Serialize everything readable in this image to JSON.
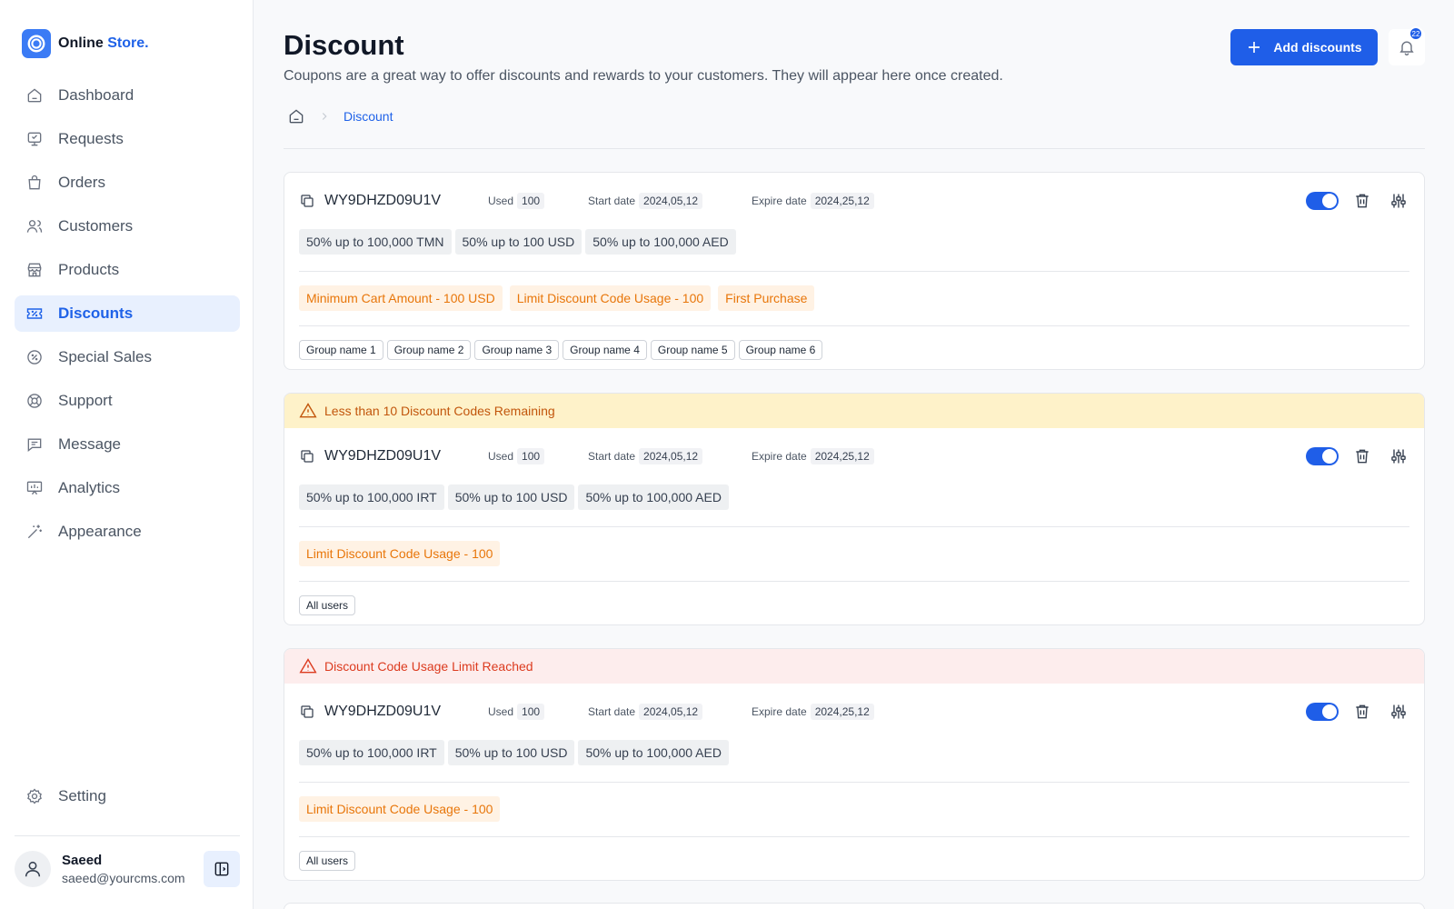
{
  "brand": {
    "name": "Online",
    "accent": "Store."
  },
  "sidebar": {
    "items": [
      {
        "label": "Dashboard",
        "icon": "dashboard-icon"
      },
      {
        "label": "Requests",
        "icon": "requests-icon"
      },
      {
        "label": "Orders",
        "icon": "orders-icon"
      },
      {
        "label": "Customers",
        "icon": "customers-icon"
      },
      {
        "label": "Products",
        "icon": "products-icon"
      },
      {
        "label": "Discounts",
        "icon": "discounts-icon",
        "active": true
      },
      {
        "label": "Special Sales",
        "icon": "special-sales-icon"
      },
      {
        "label": "Support",
        "icon": "support-icon"
      },
      {
        "label": "Message",
        "icon": "message-icon"
      },
      {
        "label": "Analytics",
        "icon": "analytics-icon"
      },
      {
        "label": "Appearance",
        "icon": "appearance-icon"
      }
    ],
    "setting_label": "Setting"
  },
  "user": {
    "name": "Saeed",
    "email": "saeed@yourcms.com"
  },
  "header": {
    "title": "Discount",
    "subtitle": "Coupons are a great way to offer discounts and rewards to your customers. They will appear here once created.",
    "add_button": "Add discounts",
    "notification_count": "22"
  },
  "breadcrumb": {
    "current": "Discount"
  },
  "labels": {
    "used": "Used",
    "start_date": "Start date",
    "expire_date": "Expire date"
  },
  "colors": {
    "primary": "#1f5ee8",
    "warning_bg": "#fef2c9",
    "danger_bg": "#fdeded",
    "condition": "#e8760a"
  },
  "discounts": [
    {
      "alert": null,
      "code": "WY9DHZD09U1V",
      "used": "100",
      "start_date": "2024,05,12",
      "expire_date": "2024,25,12",
      "enabled": true,
      "prices": [
        "50% up to 100,000 TMN",
        "50% up to 100 USD",
        "50% up to 100,000 AED"
      ],
      "conditions": [
        "Minimum Cart Amount - 100 USD",
        "Limit Discount Code Usage - 100",
        "First Purchase"
      ],
      "groups": [
        "Group name 1",
        "Group name 2",
        "Group name 3",
        "Group name 4",
        "Group name 5",
        "Group name 6"
      ]
    },
    {
      "alert": {
        "type": "warning",
        "text": "Less than 10 Discount Codes Remaining"
      },
      "code": "WY9DHZD09U1V",
      "used": "100",
      "start_date": "2024,05,12",
      "expire_date": "2024,25,12",
      "enabled": true,
      "prices": [
        "50% up to 100,000 IRT",
        "50% up to 100 USD",
        "50% up to 100,000 AED"
      ],
      "conditions": [
        "Limit Discount Code Usage - 100"
      ],
      "groups": [
        "All users"
      ]
    },
    {
      "alert": {
        "type": "danger",
        "text": "Discount Code Usage Limit Reached"
      },
      "code": "WY9DHZD09U1V",
      "used": "100",
      "start_date": "2024,05,12",
      "expire_date": "2024,25,12",
      "enabled": true,
      "prices": [
        "50% up to 100,000 IRT",
        "50% up to 100 USD",
        "50% up to 100,000 AED"
      ],
      "conditions": [
        "Limit Discount Code Usage - 100"
      ],
      "groups": [
        "All users"
      ]
    }
  ]
}
